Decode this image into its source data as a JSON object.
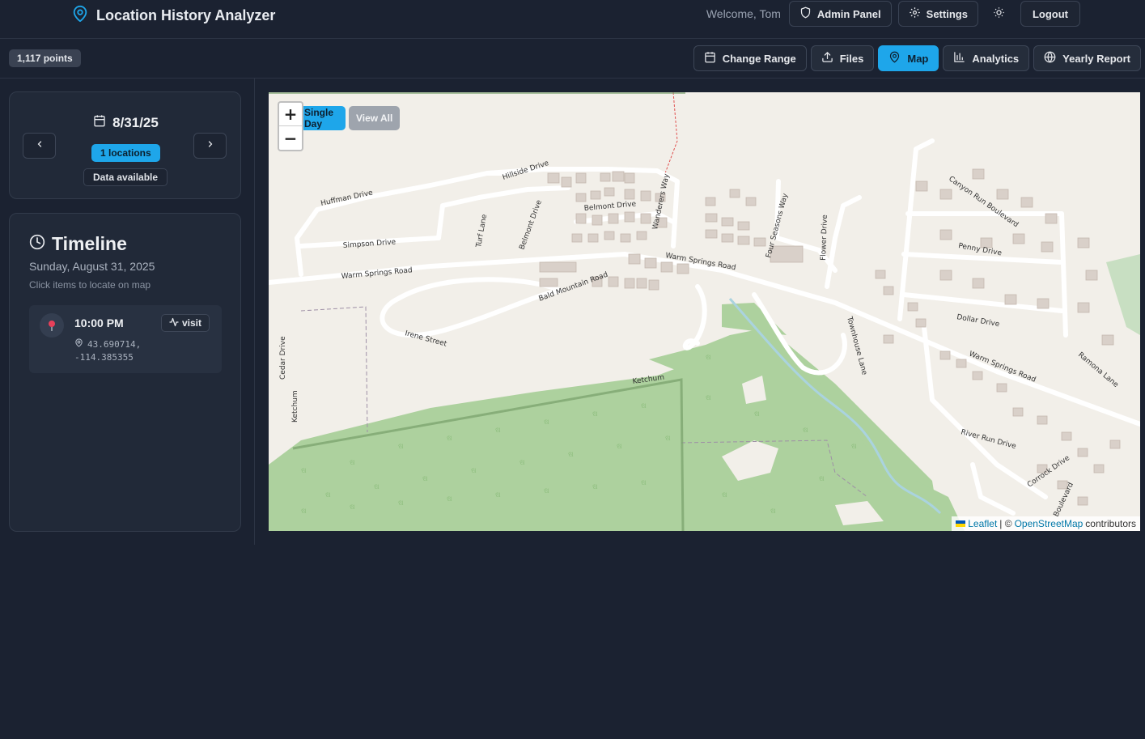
{
  "app": {
    "title": "Location History Analyzer"
  },
  "header": {
    "welcome": "Welcome, Tom",
    "admin_label": "Admin Panel",
    "settings_label": "Settings",
    "logout_label": "Logout"
  },
  "toolbar": {
    "points": "1,117 points",
    "buttons": [
      {
        "label": "Change Range",
        "icon": "calendar-icon"
      },
      {
        "label": "Files",
        "icon": "upload-icon"
      },
      {
        "label": "Map",
        "icon": "map-pin-icon",
        "active": true
      },
      {
        "label": "Analytics",
        "icon": "bar-chart-icon"
      },
      {
        "label": "Yearly Report",
        "icon": "globe-icon"
      }
    ]
  },
  "date_card": {
    "date": "8/31/25",
    "locations_badge": "1 locations",
    "availability": "Data available"
  },
  "timeline": {
    "title": "Timeline",
    "date_long": "Sunday, August 31, 2025",
    "hint": "Click items to locate on map",
    "items": [
      {
        "time": "10:00 PM",
        "type": "visit",
        "coords_line1": "43.690714,",
        "coords_line2": "-114.385355"
      }
    ]
  },
  "map": {
    "single_day_label": "Single Day",
    "view_all_label": "View All",
    "zoom_in": "+",
    "zoom_out": "−",
    "attribution": {
      "leaflet": "Leaflet",
      "sep": "| ©",
      "osm": "OpenStreetMap",
      "suffix": "contributors"
    },
    "streets": [
      "Huffman Drive",
      "Hillside Drive",
      "Simpson Drive",
      "Turf Lane",
      "Belmont Drive",
      "Belmont Drive",
      "Wanderers Way",
      "Four Seasons Way",
      "Flower Drive",
      "Warm Springs Road",
      "Warm Springs Road",
      "Bald Mountain Road",
      "Irene Street",
      "Cedar Drive",
      "Ketchum",
      "Ketchum",
      "Canyon Run Boulevard",
      "Penny Drive",
      "Dollar Drive",
      "Townhouse Lane",
      "Ramona Lane",
      "Warm Springs Road",
      "River Run Drive",
      "Corrock Drive",
      "Boulevard"
    ]
  },
  "colors": {
    "accent": "#1ea6ea",
    "background": "#1b2231",
    "card": "#212938",
    "forest": "#add19e",
    "map_bg": "#f2efe9"
  }
}
